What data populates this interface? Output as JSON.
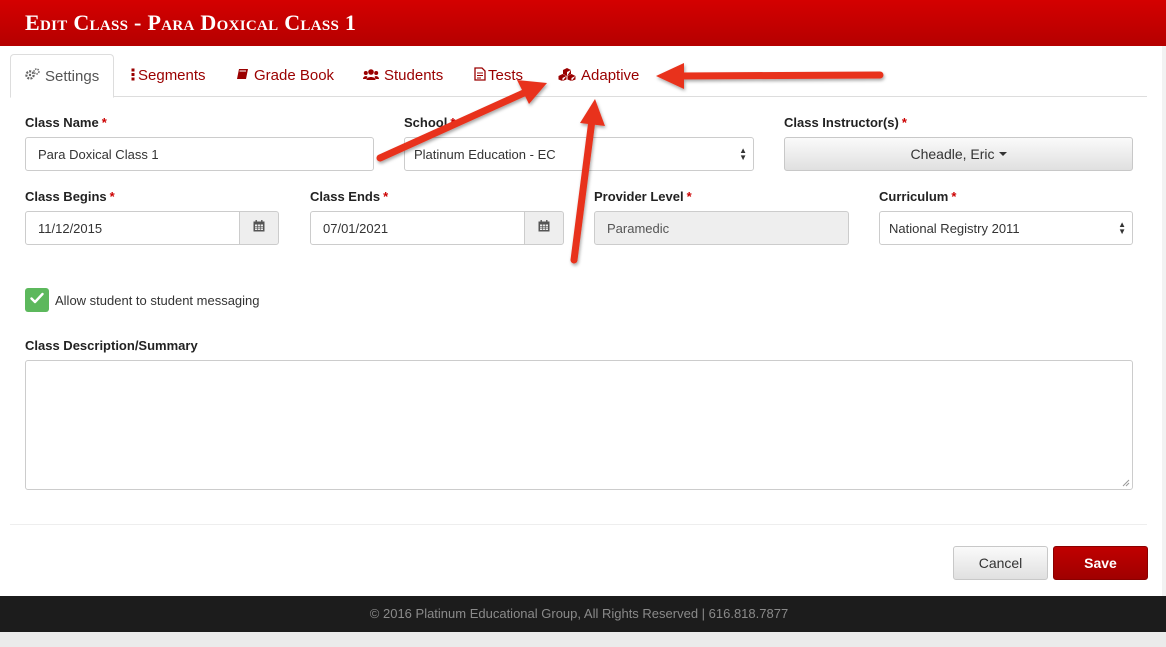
{
  "header": {
    "title": "Edit Class - Para Doxical Class 1"
  },
  "tabs": [
    {
      "label": "Settings",
      "icon": "gears-icon"
    },
    {
      "label": "Segments",
      "icon": "list-icon"
    },
    {
      "label": "Grade Book",
      "icon": "book-icon"
    },
    {
      "label": "Students",
      "icon": "users-icon"
    },
    {
      "label": "Tests",
      "icon": "document-icon"
    },
    {
      "label": "Adaptive",
      "icon": "cubes-icon"
    }
  ],
  "form": {
    "class_name": {
      "label": "Class Name",
      "required": "*",
      "value": "Para Doxical Class 1"
    },
    "school": {
      "label": "School",
      "required": "*",
      "value": "Platinum Education - EC"
    },
    "instructors": {
      "label": "Class Instructor(s)",
      "required": "*",
      "value": "Cheadle, Eric"
    },
    "class_begins": {
      "label": "Class Begins",
      "required": "*",
      "value": "11/12/2015"
    },
    "class_ends": {
      "label": "Class Ends",
      "required": "*",
      "value": "07/01/2021"
    },
    "provider_level": {
      "label": "Provider Level",
      "required": "*",
      "value": "Paramedic"
    },
    "curriculum": {
      "label": "Curriculum",
      "required": "*",
      "value": "National Registry 2011"
    },
    "messaging": {
      "label": "Allow student to student messaging",
      "checked": true
    },
    "description": {
      "label": "Class Description/Summary",
      "value": ""
    }
  },
  "actions": {
    "cancel": "Cancel",
    "save": "Save"
  },
  "footer": {
    "text": "© 2016 Platinum Educational Group, All Rights Reserved | 616.818.7877"
  },
  "colors": {
    "brand": "#c00000",
    "tab_link": "#9a0000",
    "annotation_arrow": "#e8321e",
    "checkbox": "#5cb85c"
  }
}
